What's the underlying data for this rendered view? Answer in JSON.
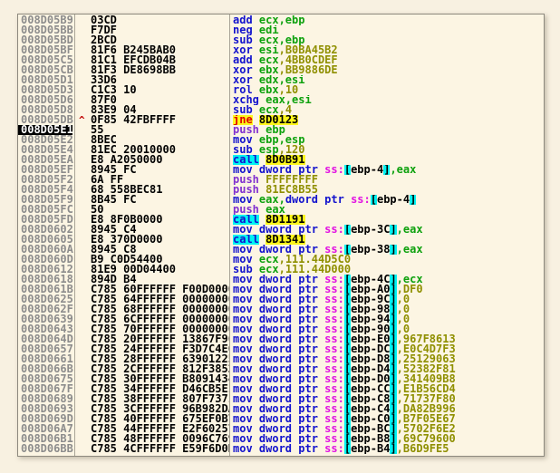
{
  "app": {
    "name": "debugger-disassembly-view",
    "colors": {
      "background": "#f8f1e1",
      "panel_background": "#fcf5e3",
      "address_gray": "#8c8c8c",
      "selection_black": "#000000",
      "mnemonic_blue": "#1212cd",
      "push_purple": "#8030d0",
      "register_green": "#0da10d",
      "immediate_olive": "#8f8f00",
      "segment_magenta": "#e214e2",
      "highlight_cyan": "#00f2f2",
      "highlight_yellow": "#fdf61b",
      "jump_red": "#e00000"
    }
  },
  "disassembly": {
    "selected_address": "008D05E1",
    "rows": [
      {
        "addr": "008D05B9",
        "bytes": "03CD",
        "tokens": [
          [
            "add ",
            "mn"
          ],
          [
            "ecx,ebp",
            "rg"
          ]
        ]
      },
      {
        "addr": "008D05BB",
        "bytes": "F7DF",
        "tokens": [
          [
            "neg ",
            "mn"
          ],
          [
            "edi",
            "rg"
          ]
        ]
      },
      {
        "addr": "008D05BD",
        "bytes": "2BCD",
        "tokens": [
          [
            "sub ",
            "mn"
          ],
          [
            "ecx,ebp",
            "rg"
          ]
        ]
      },
      {
        "addr": "008D05BF",
        "bytes": "81F6 B245BAB0",
        "tokens": [
          [
            "xor ",
            "mn"
          ],
          [
            "esi",
            "rg"
          ],
          [
            ",B0BA45B2",
            "im"
          ]
        ]
      },
      {
        "addr": "008D05C5",
        "bytes": "81C1 EFCDB04B",
        "tokens": [
          [
            "add ",
            "mn"
          ],
          [
            "ecx",
            "rg"
          ],
          [
            ",4BB0CDEF",
            "im"
          ]
        ]
      },
      {
        "addr": "008D05CB",
        "bytes": "81F3 DE8698BB",
        "tokens": [
          [
            "xor ",
            "mn"
          ],
          [
            "ebx",
            "rg"
          ],
          [
            ",BB9886DE",
            "im"
          ]
        ]
      },
      {
        "addr": "008D05D1",
        "bytes": "33D6",
        "tokens": [
          [
            "xor ",
            "mn"
          ],
          [
            "edx,esi",
            "rg"
          ]
        ]
      },
      {
        "addr": "008D05D3",
        "bytes": "C1C3 10",
        "tokens": [
          [
            "rol ",
            "mn"
          ],
          [
            "ebx",
            "rg"
          ],
          [
            ",10",
            "im"
          ]
        ]
      },
      {
        "addr": "008D05D6",
        "bytes": "87F0",
        "tokens": [
          [
            "xchg ",
            "mn"
          ],
          [
            "eax,esi",
            "rg"
          ]
        ]
      },
      {
        "addr": "008D05D8",
        "bytes": "83E9 04",
        "tokens": [
          [
            "sub ",
            "mn"
          ],
          [
            "ecx",
            "rg"
          ],
          [
            ",4",
            "im"
          ]
        ]
      },
      {
        "addr": "008D05DB",
        "bytes": "0F85 42FBFFFF",
        "arrow": "up",
        "tokens": [
          [
            "jne",
            "jy"
          ],
          [
            " ",
            "pl"
          ],
          [
            "8D0123",
            "ty"
          ]
        ]
      },
      {
        "addr": "008D05E1",
        "bytes": "55",
        "selected": true,
        "tokens": [
          [
            "push ",
            "pu"
          ],
          [
            "ebp",
            "rg"
          ]
        ]
      },
      {
        "addr": "008D05E2",
        "bytes": "8BEC",
        "tokens": [
          [
            "mov ",
            "mn"
          ],
          [
            "ebp,esp",
            "rg"
          ]
        ]
      },
      {
        "addr": "008D05E4",
        "bytes": "81EC 20010000",
        "tokens": [
          [
            "sub ",
            "mn"
          ],
          [
            "esp",
            "rg"
          ],
          [
            ",120",
            "im"
          ]
        ]
      },
      {
        "addr": "008D05EA",
        "bytes": "E8 A2050000",
        "tokens": [
          [
            "call",
            "cl"
          ],
          [
            " ",
            "pl"
          ],
          [
            "8D0B91",
            "ty"
          ]
        ]
      },
      {
        "addr": "008D05EF",
        "bytes": "8945 FC",
        "tokens": [
          [
            "mov dword ptr ",
            "mn"
          ],
          [
            "ss:",
            "sg"
          ],
          [
            "[",
            "br"
          ],
          [
            "ebp-4",
            "pl"
          ],
          [
            "]",
            "br"
          ],
          [
            ",eax",
            "rg"
          ]
        ]
      },
      {
        "addr": "008D05F2",
        "bytes": "6A FF",
        "tokens": [
          [
            "push ",
            "pu"
          ],
          [
            "FFFFFFFF",
            "im"
          ]
        ]
      },
      {
        "addr": "008D05F4",
        "bytes": "68 558BEC81",
        "tokens": [
          [
            "push ",
            "pu"
          ],
          [
            "81EC8B55",
            "im"
          ]
        ]
      },
      {
        "addr": "008D05F9",
        "bytes": "8B45 FC",
        "tokens": [
          [
            "mov ",
            "mn"
          ],
          [
            "eax,",
            "rg"
          ],
          [
            "dword ptr ",
            "mn"
          ],
          [
            "ss:",
            "sg"
          ],
          [
            "[",
            "br"
          ],
          [
            "ebp-4",
            "pl"
          ],
          [
            "]",
            "br"
          ]
        ]
      },
      {
        "addr": "008D05FC",
        "bytes": "50",
        "tokens": [
          [
            "push ",
            "pu"
          ],
          [
            "eax",
            "rg"
          ]
        ]
      },
      {
        "addr": "008D05FD",
        "bytes": "E8 8F0B0000",
        "tokens": [
          [
            "call",
            "cl"
          ],
          [
            " ",
            "pl"
          ],
          [
            "8D1191",
            "ty"
          ]
        ]
      },
      {
        "addr": "008D0602",
        "bytes": "8945 C4",
        "tokens": [
          [
            "mov dword ptr ",
            "mn"
          ],
          [
            "ss:",
            "sg"
          ],
          [
            "[",
            "br"
          ],
          [
            "ebp-3C",
            "pl"
          ],
          [
            "]",
            "br"
          ],
          [
            ",eax",
            "rg"
          ]
        ]
      },
      {
        "addr": "008D0605",
        "bytes": "E8 370D0000",
        "tokens": [
          [
            "call",
            "cl"
          ],
          [
            " ",
            "pl"
          ],
          [
            "8D1341",
            "ty"
          ]
        ]
      },
      {
        "addr": "008D060A",
        "bytes": "8945 C8",
        "tokens": [
          [
            "mov dword ptr ",
            "mn"
          ],
          [
            "ss:",
            "sg"
          ],
          [
            "[",
            "br"
          ],
          [
            "ebp-38",
            "pl"
          ],
          [
            "]",
            "br"
          ],
          [
            ",eax",
            "rg"
          ]
        ]
      },
      {
        "addr": "008D060D",
        "bytes": "B9 C0D54400",
        "tokens": [
          [
            "mov ",
            "mn"
          ],
          [
            "ecx",
            "rg"
          ],
          [
            ",111.44D5C0",
            "im"
          ]
        ]
      },
      {
        "addr": "008D0612",
        "bytes": "81E9 00D04400",
        "tokens": [
          [
            "sub ",
            "mn"
          ],
          [
            "ecx",
            "rg"
          ],
          [
            ",111.44D000",
            "im"
          ]
        ]
      },
      {
        "addr": "008D0618",
        "bytes": "894D B4",
        "tokens": [
          [
            "mov dword ptr ",
            "mn"
          ],
          [
            "ss:",
            "sg"
          ],
          [
            "[",
            "br"
          ],
          [
            "ebp-4C",
            "pl"
          ],
          [
            "]",
            "br"
          ],
          [
            ",ecx",
            "rg"
          ]
        ]
      },
      {
        "addr": "008D061B",
        "bytes": "C785 60FFFFFF F00D0000",
        "tokens": [
          [
            "mov dword ptr ",
            "mn"
          ],
          [
            "ss:",
            "sg"
          ],
          [
            "[",
            "br"
          ],
          [
            "ebp-A0",
            "pl"
          ],
          [
            "]",
            "br"
          ],
          [
            ",DF0",
            "im"
          ]
        ]
      },
      {
        "addr": "008D0625",
        "bytes": "C785 64FFFFFF 00000000",
        "tokens": [
          [
            "mov dword ptr ",
            "mn"
          ],
          [
            "ss:",
            "sg"
          ],
          [
            "[",
            "br"
          ],
          [
            "ebp-9C",
            "pl"
          ],
          [
            "]",
            "br"
          ],
          [
            ",0",
            "im"
          ]
        ]
      },
      {
        "addr": "008D062F",
        "bytes": "C785 68FFFFFF 00000000",
        "tokens": [
          [
            "mov dword ptr ",
            "mn"
          ],
          [
            "ss:",
            "sg"
          ],
          [
            "[",
            "br"
          ],
          [
            "ebp-98",
            "pl"
          ],
          [
            "]",
            "br"
          ],
          [
            ",0",
            "im"
          ]
        ]
      },
      {
        "addr": "008D0639",
        "bytes": "C785 6CFFFFFF 00000000",
        "tokens": [
          [
            "mov dword ptr ",
            "mn"
          ],
          [
            "ss:",
            "sg"
          ],
          [
            "[",
            "br"
          ],
          [
            "ebp-94",
            "pl"
          ],
          [
            "]",
            "br"
          ],
          [
            ",0",
            "im"
          ]
        ]
      },
      {
        "addr": "008D0643",
        "bytes": "C785 70FFFFFF 00000000",
        "tokens": [
          [
            "mov dword ptr ",
            "mn"
          ],
          [
            "ss:",
            "sg"
          ],
          [
            "[",
            "br"
          ],
          [
            "ebp-90",
            "pl"
          ],
          [
            "]",
            "br"
          ],
          [
            ",0",
            "im"
          ]
        ]
      },
      {
        "addr": "008D064D",
        "bytes": "C785 20FFFFFF 13867F96",
        "tokens": [
          [
            "mov dword ptr ",
            "mn"
          ],
          [
            "ss:",
            "sg"
          ],
          [
            "[",
            "br"
          ],
          [
            "ebp-E0",
            "pl"
          ],
          [
            "]",
            "br"
          ],
          [
            ",967F8613",
            "im"
          ]
        ]
      },
      {
        "addr": "008D0657",
        "bytes": "C785 24FFFFFF F3D7C4E0",
        "tokens": [
          [
            "mov dword ptr ",
            "mn"
          ],
          [
            "ss:",
            "sg"
          ],
          [
            "[",
            "br"
          ],
          [
            "ebp-DC",
            "pl"
          ],
          [
            "]",
            "br"
          ],
          [
            ",E0C4D7F3",
            "im"
          ]
        ]
      },
      {
        "addr": "008D0661",
        "bytes": "C785 28FFFFFF 63901225",
        "tokens": [
          [
            "mov dword ptr ",
            "mn"
          ],
          [
            "ss:",
            "sg"
          ],
          [
            "[",
            "br"
          ],
          [
            "ebp-D8",
            "pl"
          ],
          [
            "]",
            "br"
          ],
          [
            ",25129063",
            "im"
          ]
        ]
      },
      {
        "addr": "008D066B",
        "bytes": "C785 2CFFFFFF 812F3852",
        "tokens": [
          [
            "mov dword ptr ",
            "mn"
          ],
          [
            "ss:",
            "sg"
          ],
          [
            "[",
            "br"
          ],
          [
            "ebp-D4",
            "pl"
          ],
          [
            "]",
            "br"
          ],
          [
            ",52382F81",
            "im"
          ]
        ]
      },
      {
        "addr": "008D0675",
        "bytes": "C785 30FFFFFF B8091434",
        "tokens": [
          [
            "mov dword ptr ",
            "mn"
          ],
          [
            "ss:",
            "sg"
          ],
          [
            "[",
            "br"
          ],
          [
            "ebp-D0",
            "pl"
          ],
          [
            "]",
            "br"
          ],
          [
            ",341409B8",
            "im"
          ]
        ]
      },
      {
        "addr": "008D067F",
        "bytes": "C785 34FFFFFF D46CB5E1",
        "tokens": [
          [
            "mov dword ptr ",
            "mn"
          ],
          [
            "ss:",
            "sg"
          ],
          [
            "[",
            "br"
          ],
          [
            "ebp-CC",
            "pl"
          ],
          [
            "]",
            "br"
          ],
          [
            ",E1B56CD4",
            "im"
          ]
        ]
      },
      {
        "addr": "008D0689",
        "bytes": "C785 38FFFFFF 807F7371",
        "tokens": [
          [
            "mov dword ptr ",
            "mn"
          ],
          [
            "ss:",
            "sg"
          ],
          [
            "[",
            "br"
          ],
          [
            "ebp-C8",
            "pl"
          ],
          [
            "]",
            "br"
          ],
          [
            ",71737F80",
            "im"
          ]
        ]
      },
      {
        "addr": "008D0693",
        "bytes": "C785 3CFFFFFF 96B982DA",
        "tokens": [
          [
            "mov dword ptr ",
            "mn"
          ],
          [
            "ss:",
            "sg"
          ],
          [
            "[",
            "br"
          ],
          [
            "ebp-C4",
            "pl"
          ],
          [
            "]",
            "br"
          ],
          [
            ",DA82B996",
            "im"
          ]
        ]
      },
      {
        "addr": "008D069D",
        "bytes": "C785 40FFFFFF 675EF0B7",
        "tokens": [
          [
            "mov dword ptr ",
            "mn"
          ],
          [
            "ss:",
            "sg"
          ],
          [
            "[",
            "br"
          ],
          [
            "ebp-C0",
            "pl"
          ],
          [
            "]",
            "br"
          ],
          [
            ",B7F05E67",
            "im"
          ]
        ]
      },
      {
        "addr": "008D06A7",
        "bytes": "C785 44FFFFFF E2F60257",
        "tokens": [
          [
            "mov dword ptr ",
            "mn"
          ],
          [
            "ss:",
            "sg"
          ],
          [
            "[",
            "br"
          ],
          [
            "ebp-BC",
            "pl"
          ],
          [
            "]",
            "br"
          ],
          [
            ",5702F6E2",
            "im"
          ]
        ]
      },
      {
        "addr": "008D06B1",
        "bytes": "C785 48FFFFFF 0096C769",
        "tokens": [
          [
            "mov dword ptr ",
            "mn"
          ],
          [
            "ss:",
            "sg"
          ],
          [
            "[",
            "br"
          ],
          [
            "ebp-B8",
            "pl"
          ],
          [
            "]",
            "br"
          ],
          [
            ",69C79600",
            "im"
          ]
        ]
      },
      {
        "addr": "008D06BB",
        "bytes": "C785 4CFFFFFF E59F6D0B",
        "tokens": [
          [
            "mov dword ptr ",
            "mn"
          ],
          [
            "ss:",
            "sg"
          ],
          [
            "[",
            "br"
          ],
          [
            "ebp-B4",
            "pl"
          ],
          [
            "]",
            "br"
          ],
          [
            ",B6D9FE5",
            "im"
          ]
        ]
      }
    ]
  }
}
